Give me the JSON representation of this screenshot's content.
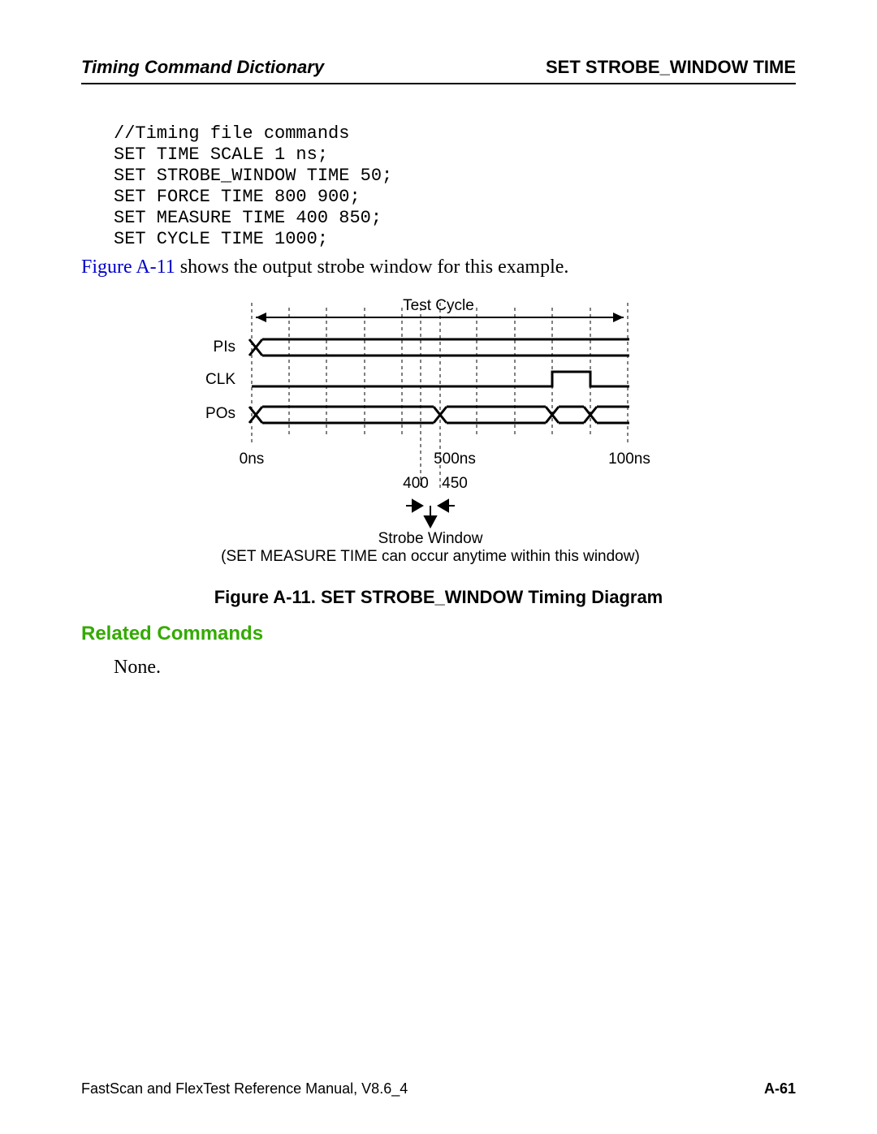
{
  "header": {
    "left": "Timing Command Dictionary",
    "right": "SET STROBE_WINDOW TIME"
  },
  "code": "//Timing file commands\nSET TIME SCALE 1 ns;\nSET STROBE_WINDOW TIME 50;\nSET FORCE TIME 800 900;\nSET MEASURE TIME 400 850;\nSET CYCLE TIME 1000;",
  "para": {
    "link": "Figure A-11",
    "rest": " shows the output strobe window for this example."
  },
  "diagram": {
    "test_cycle": "Test Cycle",
    "pis": "PIs",
    "clk": "CLK",
    "pos": "POs",
    "t0": "0ns",
    "t500": "500ns",
    "t1000": "100ns",
    "v400": "400",
    "v450": "450",
    "strobe": "Strobe Window",
    "note": "(SET MEASURE TIME can occur anytime within this window)"
  },
  "caption": "Figure A-11. SET STROBE_WINDOW Timing Diagram",
  "related_heading": "Related Commands",
  "none": "None.",
  "footer": {
    "left": "FastScan and FlexTest Reference Manual, V8.6_4",
    "right": "A-61"
  }
}
